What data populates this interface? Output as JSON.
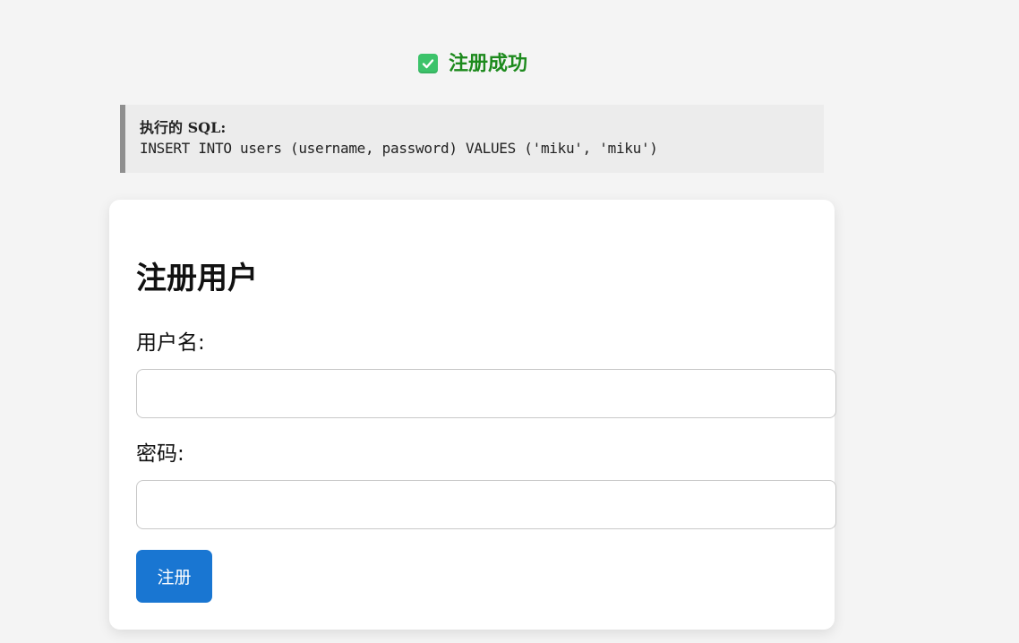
{
  "status": {
    "icon": "check-mark-button-icon",
    "message": "注册成功",
    "color": "#1d8a1d"
  },
  "sql": {
    "heading": "执行的 SQL:",
    "query": "INSERT INTO users (username, password) VALUES ('miku', 'miku')"
  },
  "form": {
    "title": "注册用户",
    "username_label": "用户名:",
    "username_value": "",
    "password_label": "密码:",
    "password_value": "",
    "submit_label": "注册",
    "button_color": "#1976d2"
  }
}
